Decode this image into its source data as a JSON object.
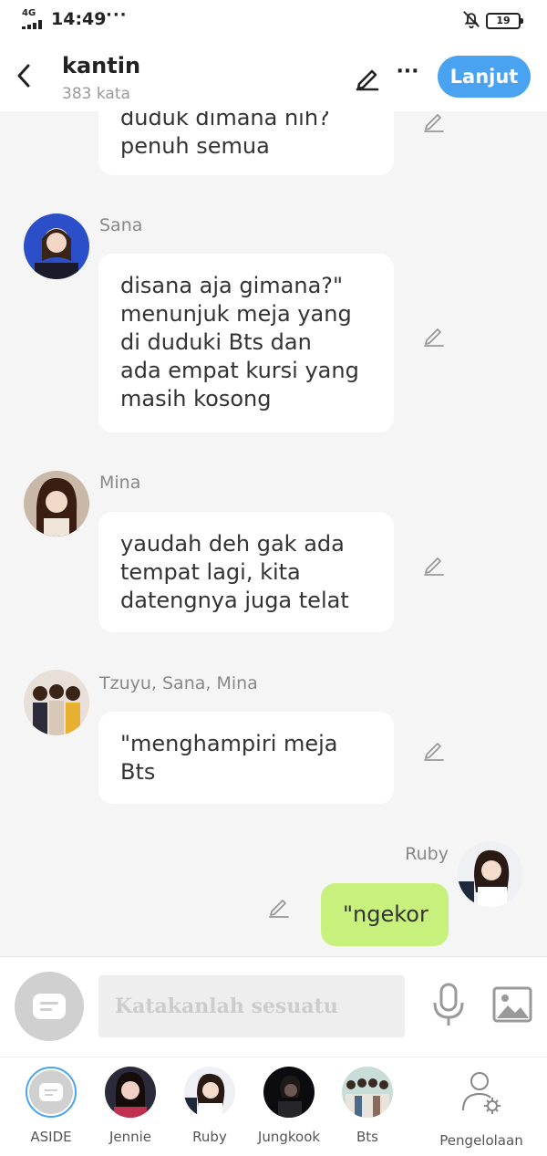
{
  "status_bar": {
    "network": "4G",
    "time": "14:49",
    "dots": "···",
    "battery": "19"
  },
  "header": {
    "title": "kantin",
    "subtitle": "383 kata",
    "more": "···",
    "continue_label": "Lanjut"
  },
  "messages": [
    {
      "sender": "",
      "text": "duduk dimana nih?\npenuh semua",
      "side": "left"
    },
    {
      "sender": "Sana",
      "text": "disana aja gimana?\"\nmenunjuk meja yang\ndi duduki Bts dan\nada empat kursi yang\nmasih kosong",
      "side": "left"
    },
    {
      "sender": "Mina",
      "text": "yaudah deh gak ada\ntempat lagi, kita\ndatengnya juga telat",
      "side": "left"
    },
    {
      "sender": "Tzuyu, Sana, Mina",
      "text": "\"menghampiri meja\nBts",
      "side": "left"
    },
    {
      "sender": "Ruby",
      "text": "\"ngekor",
      "side": "right"
    }
  ],
  "input": {
    "placeholder": "Katakanlah sesuatu"
  },
  "tabs": [
    {
      "label": "ASIDE"
    },
    {
      "label": "Jennie"
    },
    {
      "label": "Ruby"
    },
    {
      "label": "Jungkook"
    },
    {
      "label": "Bts"
    },
    {
      "label": "Pengelolaan"
    }
  ],
  "colors": {
    "accent": "#4aa3f0",
    "own_bubble": "#c8f07c",
    "background": "#f5f5f5"
  },
  "icons": {
    "back": "chevron-left-icon",
    "edit": "pencil-icon",
    "more": "more-icon",
    "mic": "microphone-icon",
    "image": "image-icon",
    "manage": "user-settings-icon",
    "bell": "bell-off-icon"
  }
}
